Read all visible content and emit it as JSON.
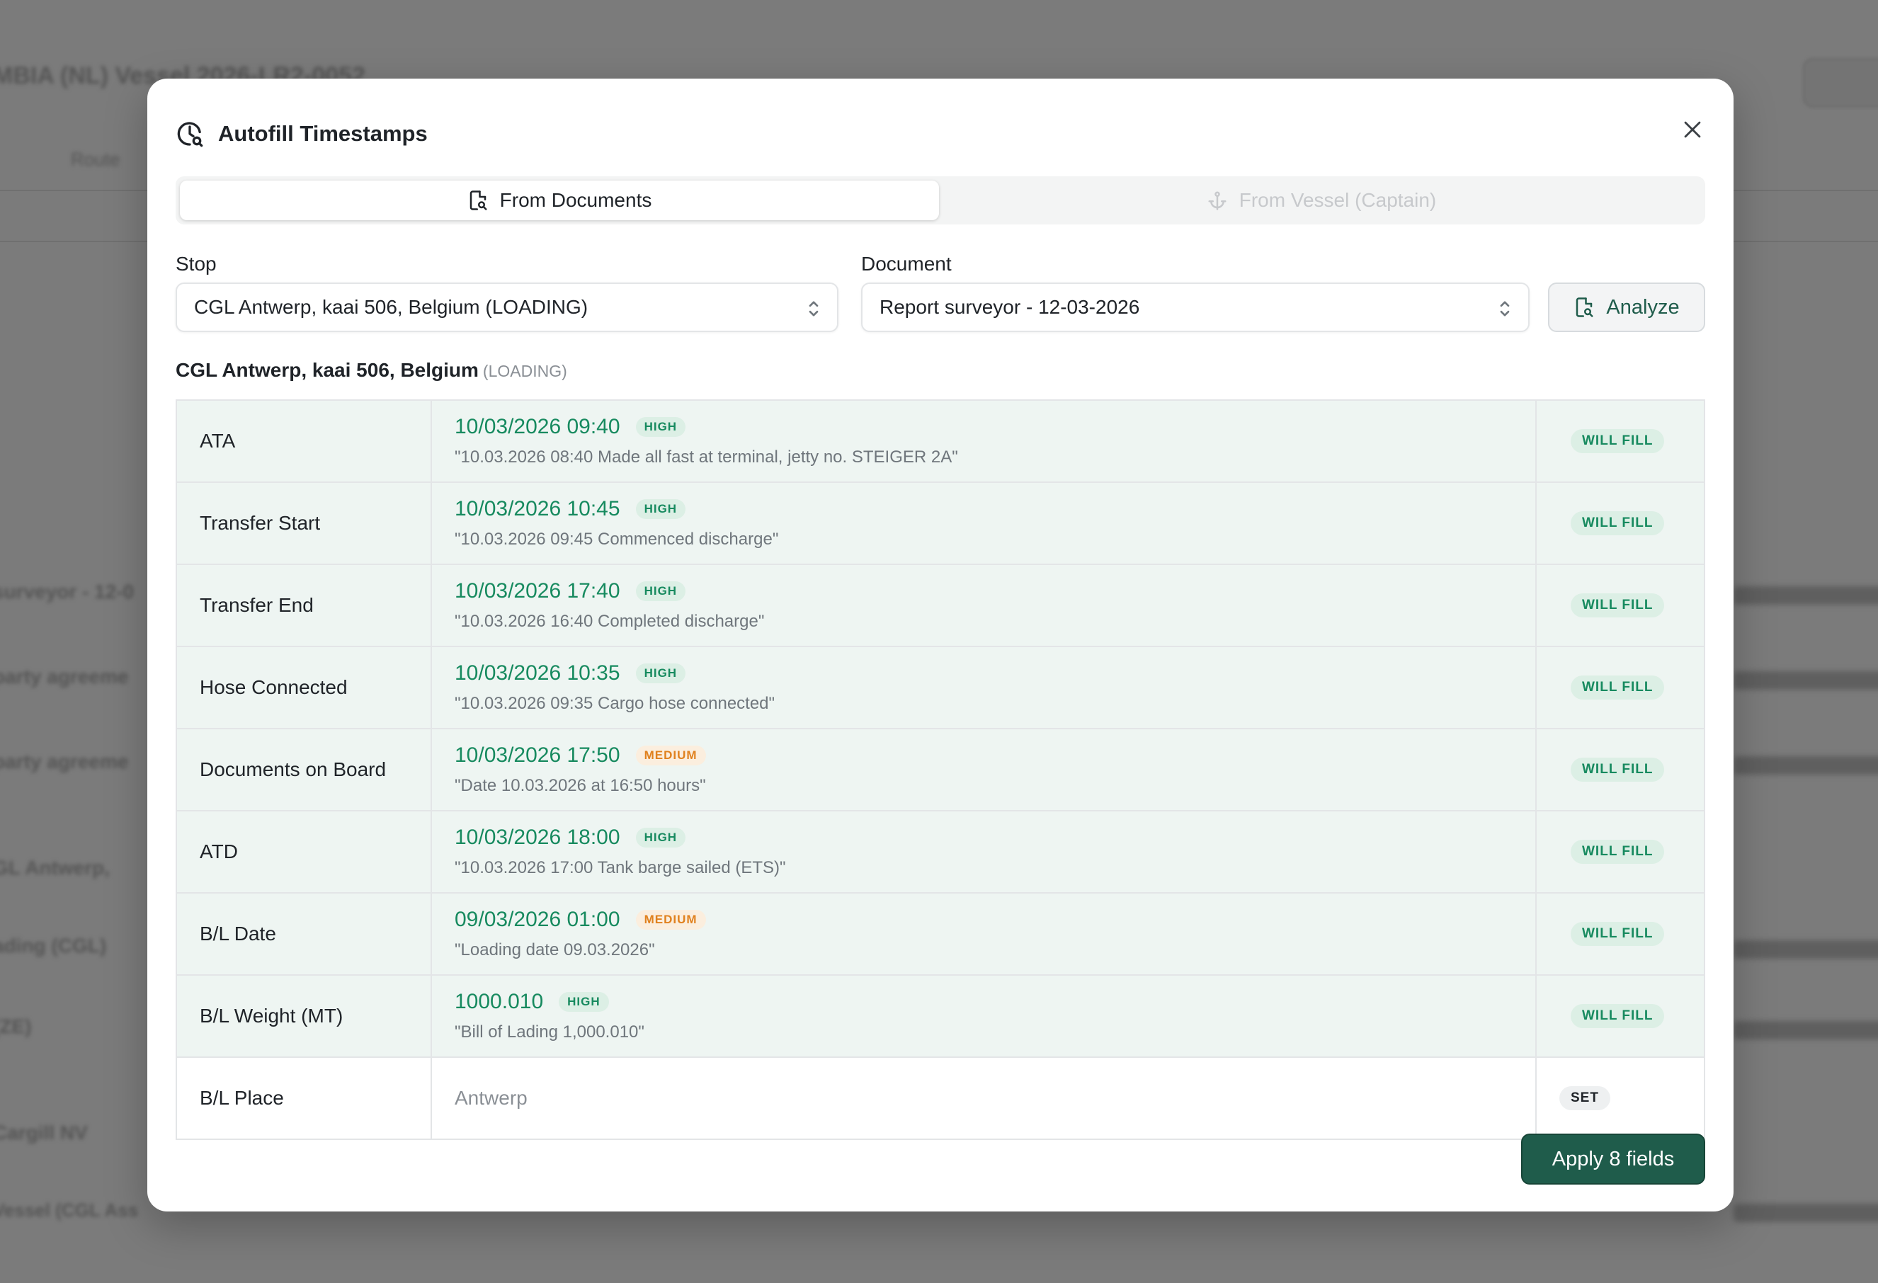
{
  "background": {
    "heading": "MBIA (NL) Vessel 2026-LR2-0052",
    "tab_label": "Route",
    "row_labels": [
      "surveyor - 12-0",
      "party agreeme",
      "party agreeme",
      "GL Antwerp,",
      "ading (CGL)",
      "(ZE)",
      "Cargill NV",
      "Vessel (CGL Ass"
    ]
  },
  "modal": {
    "title": "Autofill Timestamps",
    "title_icon": "clock-search-icon",
    "close_icon": "close-icon"
  },
  "tabs": [
    {
      "label": "From Documents",
      "icon": "document-search-icon",
      "active": true
    },
    {
      "label": "From Vessel (Captain)",
      "icon": "anchor-icon",
      "active": false
    }
  ],
  "stop": {
    "label": "Stop",
    "value": "CGL Antwerp, kaai 506, Belgium (LOADING)"
  },
  "document": {
    "label": "Document",
    "value": "Report surveyor - 12-03-2026"
  },
  "analyze": {
    "label": "Analyze",
    "icon": "document-search-icon"
  },
  "section": {
    "title": "CGL Antwerp, kaai 506, Belgium",
    "tag": "(LOADING)"
  },
  "rows": [
    {
      "label": "ATA",
      "value": "10/03/2026 09:40",
      "confidence": "HIGH",
      "quote": "\"10.03.2026 08:40 Made all fast at terminal, jetty no. STEIGER 2A\"",
      "status": "WILL FILL"
    },
    {
      "label": "Transfer Start",
      "value": "10/03/2026 10:45",
      "confidence": "HIGH",
      "quote": "\"10.03.2026 09:45 Commenced discharge\"",
      "status": "WILL FILL"
    },
    {
      "label": "Transfer End",
      "value": "10/03/2026 17:40",
      "confidence": "HIGH",
      "quote": "\"10.03.2026 16:40 Completed discharge\"",
      "status": "WILL FILL"
    },
    {
      "label": "Hose Connected",
      "value": "10/03/2026 10:35",
      "confidence": "HIGH",
      "quote": "\"10.03.2026 09:35 Cargo hose connected\"",
      "status": "WILL FILL"
    },
    {
      "label": "Documents on Board",
      "value": "10/03/2026 17:50",
      "confidence": "MEDIUM",
      "quote": "\"Date 10.03.2026 at 16:50 hours\"",
      "status": "WILL FILL"
    },
    {
      "label": "ATD",
      "value": "10/03/2026 18:00",
      "confidence": "HIGH",
      "quote": "\"10.03.2026 17:00 Tank barge sailed (ETS)\"",
      "status": "WILL FILL"
    },
    {
      "label": "B/L Date",
      "value": "09/03/2026 01:00",
      "confidence": "MEDIUM",
      "quote": "\"Loading date 09.03.2026\"",
      "status": "WILL FILL"
    },
    {
      "label": "B/L Weight (MT)",
      "value": "1000.010",
      "confidence": "HIGH",
      "quote": "\"Bill of Lading 1,000.010\"",
      "status": "WILL FILL"
    },
    {
      "label": "B/L Place",
      "value": "Antwerp",
      "status": "SET"
    }
  ],
  "apply": {
    "label": "Apply 8 fields"
  },
  "colors": {
    "accent_dark": "#1f5c4b",
    "value_green": "#178a5f",
    "row_fill_bg": "#eef5f2",
    "medium_orange": "#e0811e"
  }
}
